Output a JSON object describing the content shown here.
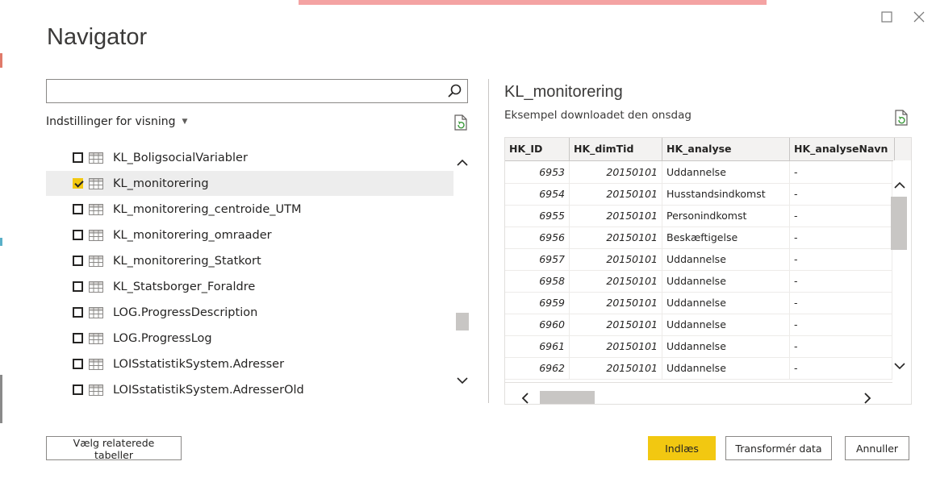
{
  "window": {
    "title": "Navigator",
    "controls": {
      "maximize_icon": "square-icon",
      "close_icon": "close-icon"
    }
  },
  "search": {
    "value": "",
    "placeholder": ""
  },
  "display_options": {
    "label": "Indstillinger for visning"
  },
  "tree": {
    "items": [
      {
        "label": "KL_BoligsocialVariabler",
        "checked": false,
        "selected": false
      },
      {
        "label": "KL_monitorering",
        "checked": true,
        "selected": true
      },
      {
        "label": "KL_monitorering_centroide_UTM",
        "checked": false,
        "selected": false
      },
      {
        "label": "KL_monitorering_omraader",
        "checked": false,
        "selected": false
      },
      {
        "label": "KL_monitorering_Statkort",
        "checked": false,
        "selected": false
      },
      {
        "label": "KL_Statsborger_Foraldre",
        "checked": false,
        "selected": false
      },
      {
        "label": "LOG.ProgressDescription",
        "checked": false,
        "selected": false
      },
      {
        "label": "LOG.ProgressLog",
        "checked": false,
        "selected": false
      },
      {
        "label": "LOISstatistikSystem.Adresser",
        "checked": false,
        "selected": false
      },
      {
        "label": "LOISstatistikSystem.AdresserOld",
        "checked": false,
        "selected": false
      }
    ]
  },
  "preview": {
    "title": "KL_monitorering",
    "subtitle": "Eksempel downloadet den onsdag",
    "columns": [
      "HK_ID",
      "HK_dimTid",
      "HK_analyse",
      "HK_analyseNavn"
    ],
    "rows": [
      [
        "6953",
        "20150101",
        "Uddannelse",
        "-"
      ],
      [
        "6954",
        "20150101",
        "Husstandsindkomst",
        "-"
      ],
      [
        "6955",
        "20150101",
        "Personindkomst",
        "-"
      ],
      [
        "6956",
        "20150101",
        "Beskæftigelse",
        "-"
      ],
      [
        "6957",
        "20150101",
        "Uddannelse",
        "-"
      ],
      [
        "6958",
        "20150101",
        "Uddannelse",
        "-"
      ],
      [
        "6959",
        "20150101",
        "Uddannelse",
        "-"
      ],
      [
        "6960",
        "20150101",
        "Uddannelse",
        "-"
      ],
      [
        "6961",
        "20150101",
        "Uddannelse",
        "-"
      ],
      [
        "6962",
        "20150101",
        "Uddannelse",
        "-"
      ]
    ]
  },
  "footer": {
    "select_related": "Vælg relaterede tabeller",
    "load": "Indlæs",
    "transform": "Transformér data",
    "cancel": "Annuller"
  },
  "colors": {
    "accent": "#f2c811",
    "selected_row": "#ededed"
  }
}
